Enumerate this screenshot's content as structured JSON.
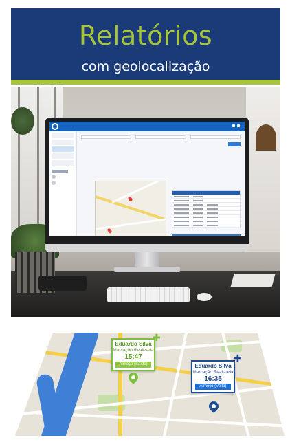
{
  "banner": {
    "title": "Relatórios",
    "subtitle": "com geolocalização"
  },
  "map_cards": [
    {
      "name": "Eduardo Silva",
      "label": "Marcação Realizada",
      "time": "15:47",
      "status": "Almoço (Saída)",
      "pin_color": "#7fbf3f"
    },
    {
      "name": "Eduardo Silva",
      "label": "Marcação Realizada",
      "time": "16:35",
      "status": "Almoço (Volta)",
      "pin_color": "#1e4c93"
    }
  ],
  "colors": {
    "banner_bg": "#1b3b78",
    "accent_green": "#a6c53c",
    "pin_green": "#7fbf3f",
    "pin_blue": "#1e4c93"
  }
}
